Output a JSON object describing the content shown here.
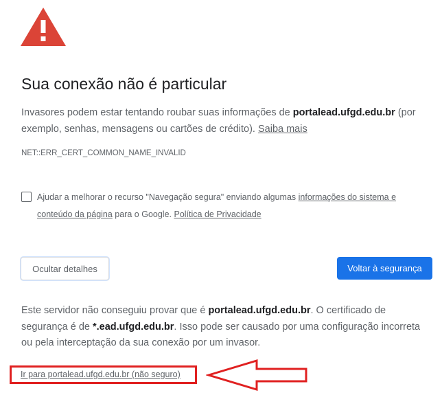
{
  "title": "Sua conexão não é particular",
  "explanation": {
    "prefix": "Invasores podem estar tentando roubar suas informações de ",
    "domain": "portalead.ufgd.edu.br",
    "middle": " (por exemplo, senhas, mensagens ou cartões de crédito). ",
    "learn_more": "Saiba mais"
  },
  "error_code": "NET::ERR_CERT_COMMON_NAME_INVALID",
  "safe_browsing_optin": {
    "checked": false,
    "prefix": "Ajudar a melhorar o recurso \"Navegação segura\" enviando algumas ",
    "link1": "informações do sistema e conteúdo da página",
    "middle": " para o Google. ",
    "link2": "Política de Privacidade"
  },
  "buttons": {
    "details": "Ocultar detalhes",
    "back_to_safety": "Voltar à segurança"
  },
  "details": {
    "part1": "Este servidor não conseguiu provar que é ",
    "domain": "portalead.ufgd.edu.br",
    "part2": ". O certificado de segurança é de ",
    "cert_domain": "*.ead.ufgd.edu.br",
    "part3": ". Isso pode ser causado por uma configuração incorreta ou pela interceptação da sua conexão por um invasor."
  },
  "proceed_link": "Ir para portalead.ufgd.edu.br (não seguro)",
  "icons": {
    "warning": "warning-triangle-icon",
    "annotation": "red-arrow-left"
  },
  "colors": {
    "warning_red": "#db4437",
    "primary_blue": "#1a73e8",
    "annotation_red": "#e02020"
  }
}
